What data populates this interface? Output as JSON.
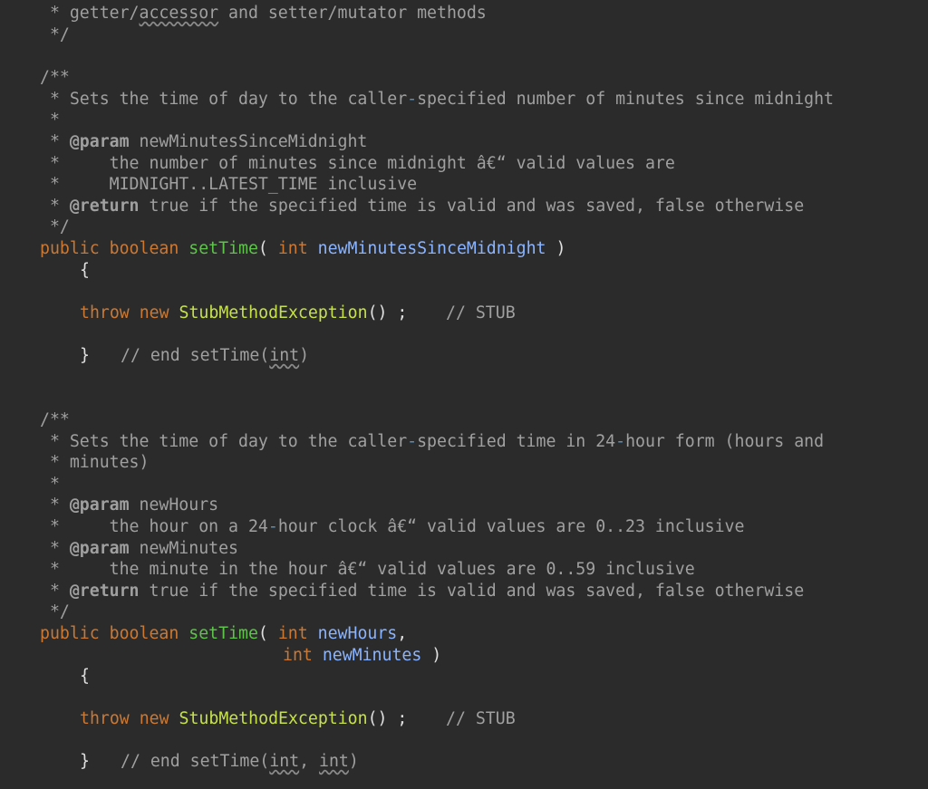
{
  "code": {
    "l1_text": " * getter/",
    "l1_squig": "accessor",
    "l1_rest": " and setter/mutator methods",
    "l2": " */",
    "doc1": {
      "open": "/**",
      "summary_a": " * Sets the time of day to the caller",
      "summary_dash": "-",
      "summary_b": "specified number of minutes since midnight",
      "blank": " *",
      "param_star": " * ",
      "param_tag": "@param",
      "param_name": " newMinutesSinceMidnight",
      "param_desc1": " *     the number of minutes since midnight â€“ valid values are",
      "param_desc2": " *     MIDNIGHT..LATEST_TIME inclusive",
      "return_star": " * ",
      "return_tag": "@return",
      "return_desc": " true if the specified time is valid and was saved, false otherwise",
      "close": " */"
    },
    "m1": {
      "public": "public",
      "boolean": "boolean",
      "name": "setTime",
      "open_paren": "( ",
      "int": "int",
      "param": "newMinutesSinceMidnight",
      "close_paren": " )",
      "brace_open": "{",
      "throw": "throw",
      "new": "new",
      "exception": "StubMethodException",
      "call": "() ;",
      "stub_comment": "// STUB",
      "brace_close": "}",
      "end_comment_a": "// end setTime(",
      "end_comment_int": "int",
      "end_comment_b": ")"
    },
    "doc2": {
      "open": "/**",
      "summary_a": " * Sets the time of day to the caller",
      "summary_dash": "-",
      "summary_b": "specified time in 24",
      "summary_dash2": "-",
      "summary_c": "hour form (hours and",
      "summary_line2": " * minutes)",
      "blank": " *",
      "p1_tag": "@param",
      "p1_name": " newHours",
      "p1_desc_a": " *     the hour on a 24",
      "p1_desc_dash": "-",
      "p1_desc_b": "hour clock â€“ valid values are 0..23 inclusive",
      "p2_tag": "@param",
      "p2_name": " newMinutes",
      "p2_desc": " *     the minute in the hour â€“ valid values are 0..59 inclusive",
      "return_tag": "@return",
      "return_desc": " true if the specified time is valid and was saved, false otherwise",
      "close": " */"
    },
    "m2": {
      "public": "public",
      "boolean": "boolean",
      "name": "setTime",
      "open_paren": "( ",
      "int": "int",
      "param1": "newHours",
      "comma": ",",
      "param2": "newMinutes",
      "close_paren": " )",
      "brace_open": "{",
      "throw": "throw",
      "new": "new",
      "exception": "StubMethodException",
      "call": "() ;",
      "stub_comment": "// STUB",
      "brace_close": "}",
      "end_comment_a": "// end setTime(",
      "end_int1": "int",
      "end_sep": ", ",
      "end_int2": "int",
      "end_comment_b": ")"
    }
  }
}
